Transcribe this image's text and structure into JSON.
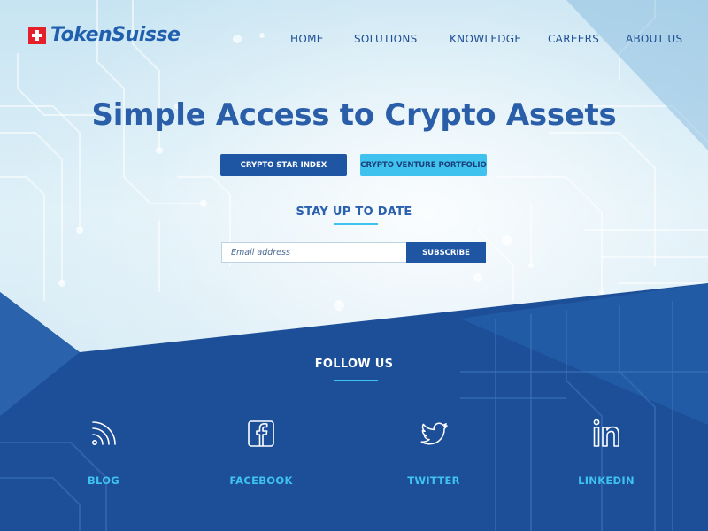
{
  "brand": {
    "name": "TokenSuisse",
    "flag_color": "#e4202a",
    "text_color": "#1f5fae"
  },
  "nav": {
    "items": [
      {
        "label": "HOME"
      },
      {
        "label": "SOLUTIONS"
      },
      {
        "label": "KNOWLEDGE"
      },
      {
        "label": "CAREERS"
      },
      {
        "label": "ABOUT US"
      }
    ]
  },
  "hero": {
    "headline": "Simple Access to Crypto Assets",
    "primary_button": "CRYPTO STAR INDEX",
    "secondary_button": "CRYPTO VENTURE PORTFOLIO"
  },
  "newsletter": {
    "title": "STAY UP TO DATE",
    "email_placeholder": "Email address",
    "email_value": "",
    "subscribe_label": "SUBSCRIBE"
  },
  "follow": {
    "title": "FOLLOW US",
    "items": [
      {
        "label": "BLOG",
        "icon": "rss-icon"
      },
      {
        "label": "FACEBOOK",
        "icon": "facebook-icon"
      },
      {
        "label": "TWITTER",
        "icon": "twitter-icon"
      },
      {
        "label": "LINKEDIN",
        "icon": "linkedin-icon"
      }
    ]
  },
  "colors": {
    "accent": "#3fc3ee",
    "primary": "#1f56a4",
    "dark_band": "#1d4f98"
  }
}
